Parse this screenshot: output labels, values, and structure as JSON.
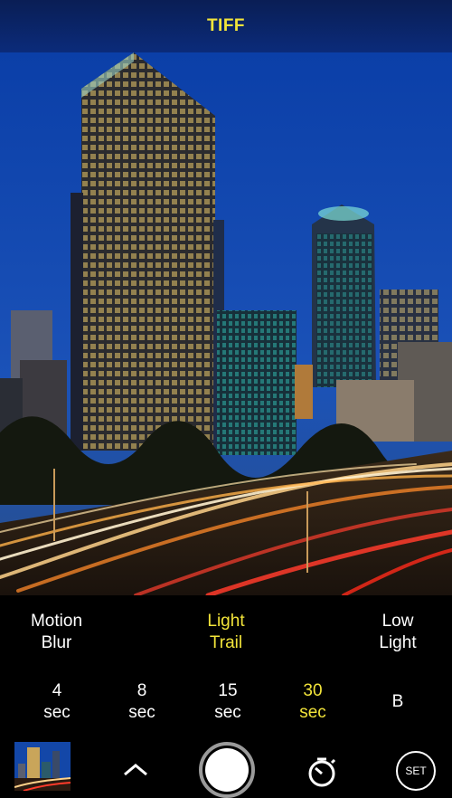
{
  "header": {
    "format_label": "TIFF",
    "accent_color": "#f2e43a"
  },
  "modes": [
    {
      "line1": "Motion",
      "line2": "Blur",
      "selected": false
    },
    {
      "line1": "Light",
      "line2": "Trail",
      "selected": true
    },
    {
      "line1": "Low",
      "line2": "Light",
      "selected": false
    }
  ],
  "exposure_times": [
    {
      "value": "4",
      "unit": "sec",
      "selected": false
    },
    {
      "value": "8",
      "unit": "sec",
      "selected": false
    },
    {
      "value": "15",
      "unit": "sec",
      "selected": false
    },
    {
      "value": "30",
      "unit": "sec",
      "selected": true
    },
    {
      "value": "B",
      "unit": "",
      "selected": false
    }
  ],
  "controls": {
    "settings_label": "SET",
    "icons": {
      "thumbnail": "gallery-thumbnail",
      "expand": "chevron-up-icon",
      "shutter": "shutter-button",
      "timer": "self-timer-icon"
    }
  }
}
